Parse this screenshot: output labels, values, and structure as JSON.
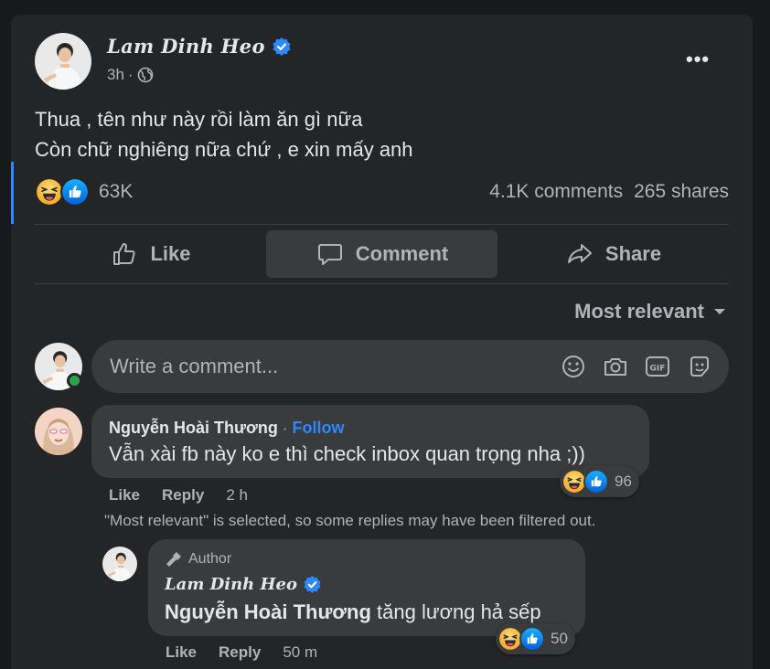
{
  "post": {
    "author": "Lam Dinh Heo",
    "time": "3h",
    "privacy_icon": "globe-icon",
    "text_lines": [
      "Thua , tên như này rồi làm ăn gì nữa",
      "Còn chữ nghiêng nữa chứ , e xin mấy anh"
    ],
    "reaction_count": "63K",
    "reaction_icons": [
      "haha-icon",
      "like-icon"
    ],
    "comments_count": "4.1K comments",
    "shares_count": "265 shares"
  },
  "actions": {
    "like": "Like",
    "comment": "Comment",
    "share": "Share"
  },
  "sort": {
    "label": "Most relevant"
  },
  "composer": {
    "placeholder": "Write a comment..."
  },
  "comments": [
    {
      "name": "Nguyễn Hoài Thương",
      "follow": "Follow",
      "separator": "·",
      "text": "Vẫn xài fb này ko e thì check inbox quan trọng nha ;))",
      "reaction_count": "96",
      "like": "Like",
      "reply": "Reply",
      "time": "2 h"
    }
  ],
  "filter_note": "\"Most relevant\" is selected, so some replies may have been filtered out.",
  "reply": {
    "badge": "Author",
    "name": "Lam Dinh Heo",
    "mention": "Nguyễn Hoài Thương",
    "text": " tăng lương hả sếp",
    "reaction_count": "50",
    "like": "Like",
    "reply": "Reply",
    "time": "50 m"
  },
  "colors": {
    "background": "#18191a",
    "card": "#242526",
    "bubble": "#3a3b3c",
    "accent": "#2d88ff",
    "online": "#31a24c",
    "haha": "#f7b125",
    "like": "#1877f2"
  }
}
